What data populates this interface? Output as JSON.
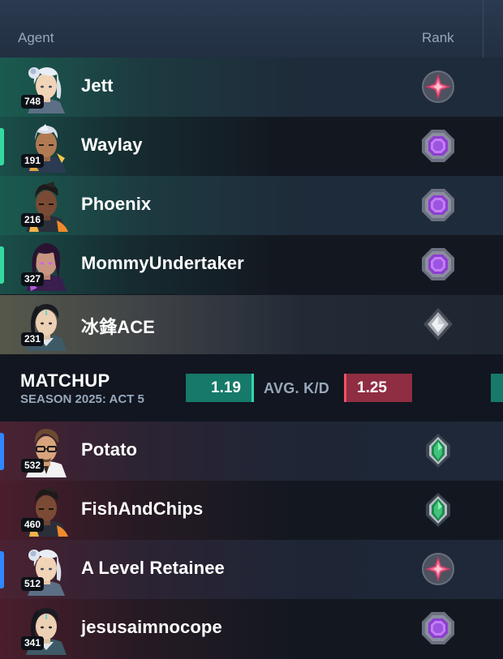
{
  "header": {
    "agent_label": "Agent",
    "rank_label": "Rank"
  },
  "team_a": [
    {
      "agent_icon": "jett-portrait-icon",
      "level": "748",
      "name": "Jett",
      "rank_icon": "diamond-rank-icon",
      "accent": false
    },
    {
      "agent_icon": "waylay-portrait-icon",
      "level": "191",
      "name": "Waylay",
      "rank_icon": "ascendant-rank-icon",
      "accent": true
    },
    {
      "agent_icon": "phoenix-portrait-icon",
      "level": "216",
      "name": "Phoenix",
      "rank_icon": "ascendant-rank-icon",
      "accent": false
    },
    {
      "agent_icon": "reyna-portrait-icon",
      "level": "327",
      "name": "MommyUndertaker",
      "rank_icon": "ascendant-rank-icon",
      "accent": true
    },
    {
      "agent_icon": "sage-portrait-icon",
      "level": "231",
      "name": "冰鋒ACE",
      "rank_icon": "platinum-rank-icon",
      "accent": false
    }
  ],
  "matchup": {
    "title": "MATCHUP",
    "season": "SEASON 2025: ACT 5",
    "kd_label": "AVG. K/D",
    "team_a_kd": "1.19",
    "team_b_kd": "1.25"
  },
  "team_b": [
    {
      "agent_icon": "chamber-portrait-icon",
      "level": "532",
      "name": "Potato",
      "rank_icon": "emerald-rank-icon",
      "accent": true
    },
    {
      "agent_icon": "phoenix-portrait-icon",
      "level": "460",
      "name": "FishAndChips",
      "rank_icon": "emerald-rank-icon",
      "accent": false
    },
    {
      "agent_icon": "jett-portrait-icon",
      "level": "512",
      "name": "A Level Retainee",
      "rank_icon": "diamond-rank-icon",
      "accent": true
    },
    {
      "agent_icon": "sage-portrait-icon",
      "level": "341",
      "name": "jesusaimnocope",
      "rank_icon": "ascendant-rank-icon",
      "accent": false
    }
  ],
  "colors": {
    "team_a": "#16796a",
    "team_a_accent": "#34d6a9",
    "team_b": "#8f2d43",
    "team_b_accent": "#ef5261",
    "team_a_row_accent": "#35d99f",
    "team_b_row_accent": "#2f88ff"
  }
}
